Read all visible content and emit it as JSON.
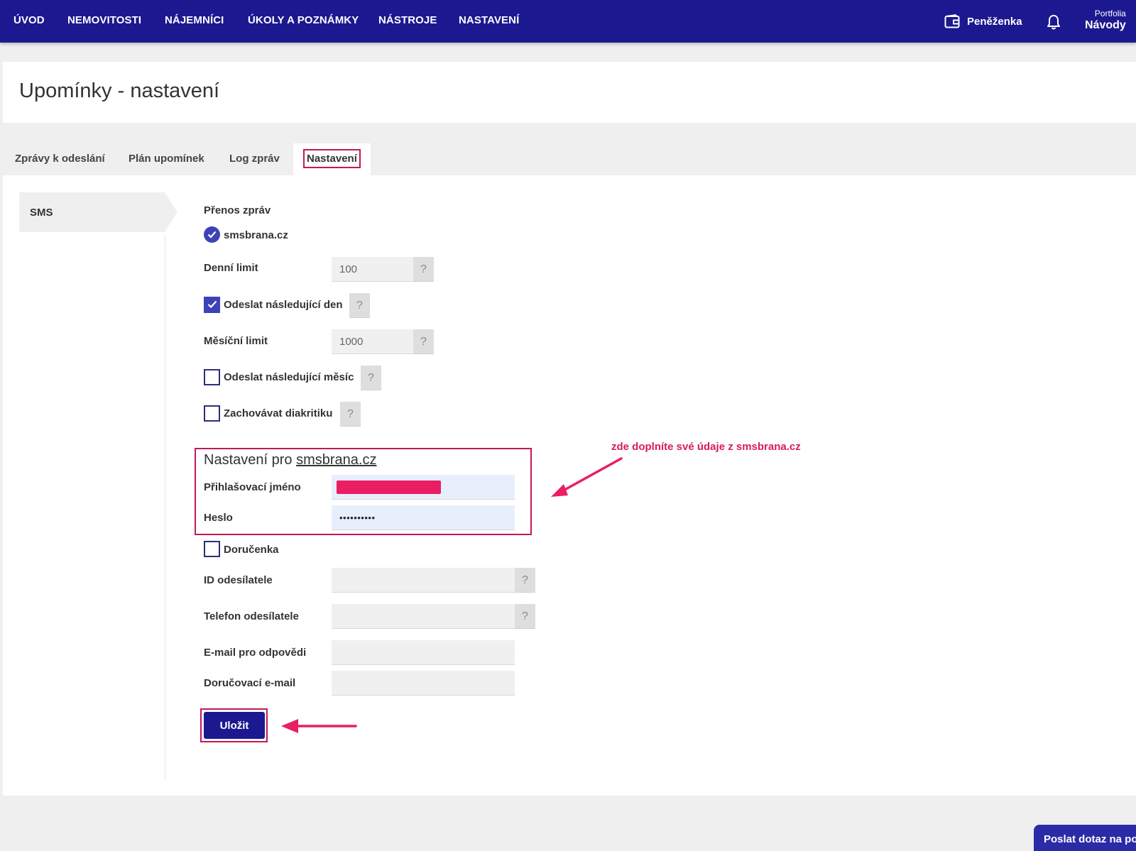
{
  "nav": {
    "items": [
      "ÚVOD",
      "NEMOVITOSTI",
      "NÁJEMNÍCI",
      "ÚKOLY A POZNÁMKY",
      "NÁSTROJE",
      "NASTAVENÍ"
    ],
    "wallet_label": "Peněženka",
    "portfolio_small": "Portfolia",
    "portfolio_big": "Návody"
  },
  "page": {
    "title": "Upomínky - nastavení"
  },
  "tabs": [
    {
      "label": "Zprávy k odeslání"
    },
    {
      "label": "Plán upomínek"
    },
    {
      "label": "Log zpráv"
    },
    {
      "label": "Nastavení",
      "active": true
    }
  ],
  "sidebar": {
    "items": [
      {
        "label": "SMS"
      }
    ]
  },
  "form": {
    "transfer_label": "Přenos zpráv",
    "provider_option": "smsbrana.cz",
    "daily_limit_label": "Denní limit",
    "daily_limit_value": "100",
    "send_next_day_label": "Odeslat následující den",
    "send_next_day_checked": true,
    "monthly_limit_label": "Měsíční limit",
    "monthly_limit_value": "1000",
    "send_next_month_label": "Odeslat následující měsíc",
    "send_next_month_checked": false,
    "keep_diacritics_label": "Zachovávat diakritiku",
    "keep_diacritics_checked": false,
    "provider_section_title_prefix": "Nastavení pro ",
    "provider_section_title_link": "smsbrana.cz",
    "login_label": "Přihlašovací jméno",
    "password_label": "Heslo",
    "password_value": "••••••••••",
    "receipt_label": "Doručenka",
    "receipt_checked": false,
    "sender_id_label": "ID odesílatele",
    "sender_phone_label": "Telefon odesílatele",
    "reply_email_label": "E-mail pro odpovědi",
    "delivery_email_label": "Doručovací e-mail",
    "help_glyph": "?",
    "save_label": "Uložit"
  },
  "annotation": {
    "text": "zde doplníte své údaje z smsbrana.cz"
  },
  "chat": {
    "label": "Poslat dotaz na podporu"
  },
  "colors": {
    "nav_bg": "#1c1890",
    "accent": "#3d43b6",
    "highlight": "#c2185b",
    "annotation": "#d81b60"
  }
}
